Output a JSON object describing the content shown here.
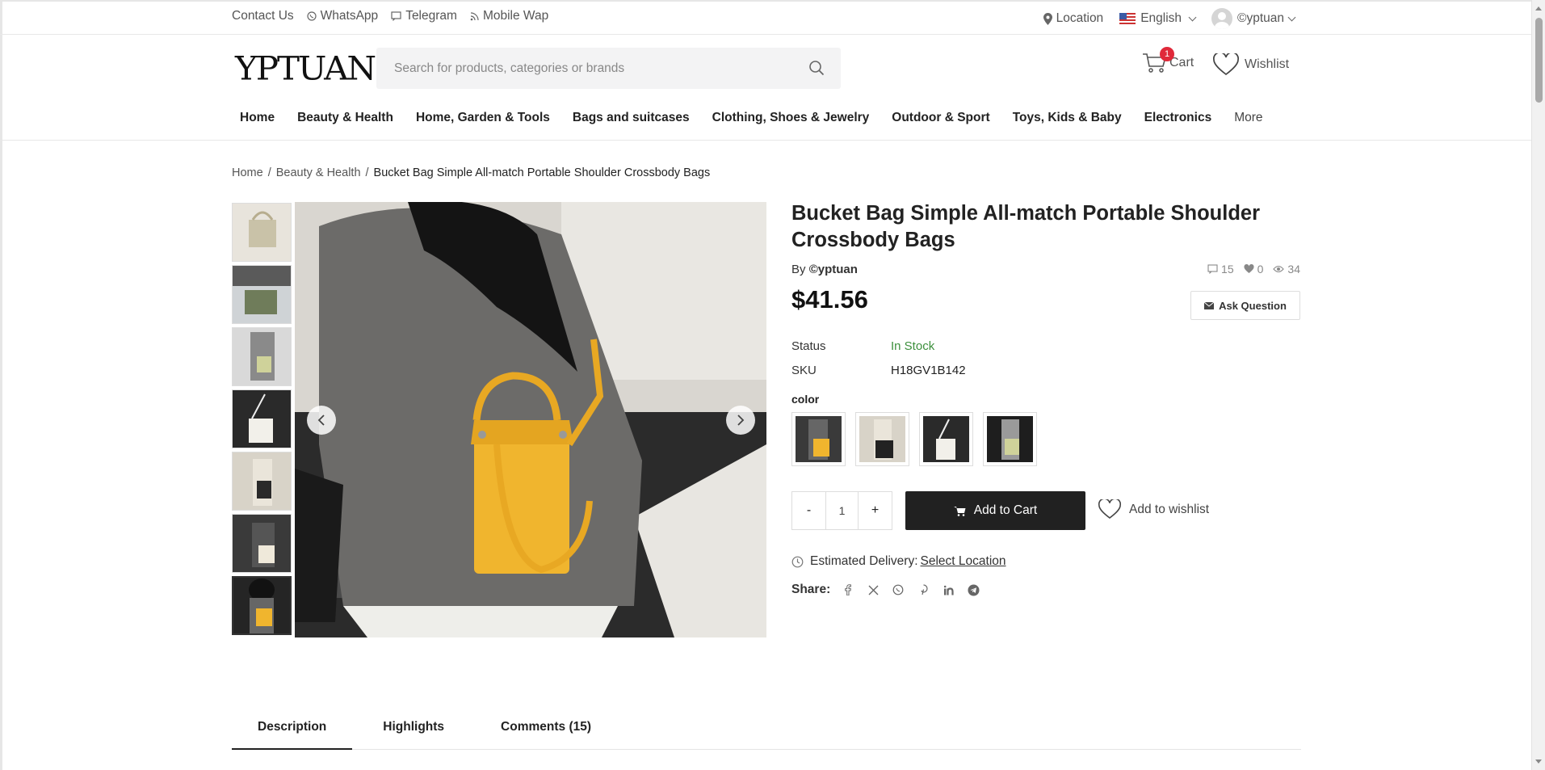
{
  "topbar": {
    "contact": "Contact Us",
    "whatsapp": "WhatsApp",
    "telegram": "Telegram",
    "mobile_wap": "Mobile Wap",
    "location": "Location",
    "language": "English",
    "user": "©yptuan"
  },
  "header": {
    "logo": "YPTUAN",
    "search_placeholder": "Search for products, categories or brands",
    "cart_label": "Cart",
    "cart_count": "1",
    "wishlist_label": "Wishlist"
  },
  "nav": {
    "items": [
      "Home",
      "Beauty & Health",
      "Home, Garden & Tools",
      "Bags and suitcases",
      "Clothing, Shoes & Jewelry",
      "Outdoor & Sport",
      "Toys, Kids & Baby",
      "Electronics",
      "More"
    ]
  },
  "breadcrumb": {
    "home": "Home",
    "category": "Beauty & Health",
    "current": "Bucket Bag Simple All-match Portable Shoulder Crossbody Bags"
  },
  "product": {
    "title": "Bucket Bag Simple All-match Portable Shoulder Crossbody Bags",
    "by_prefix": "By",
    "seller": "©yptuan",
    "comments": "15",
    "likes": "0",
    "views": "34",
    "price": "$41.56",
    "ask_question": "Ask Question",
    "status_label": "Status",
    "status_value": "In Stock",
    "sku_label": "SKU",
    "sku_value": "H18GV1B142",
    "color_label": "color",
    "quantity": "1",
    "qty_minus": "-",
    "qty_plus": "+",
    "add_to_cart": "Add to Cart",
    "add_to_wishlist": "Add to wishlist",
    "delivery_label": "Estimated Delivery:",
    "delivery_link": "Select Location",
    "share_label": "Share:"
  },
  "tabs": [
    "Description",
    "Highlights",
    "Comments (15)"
  ],
  "colors": {
    "accent_dark": "#212121",
    "in_stock": "#3c8f3c",
    "cart_badge": "#e0293a",
    "bag_yellow": "#f0b52e"
  }
}
